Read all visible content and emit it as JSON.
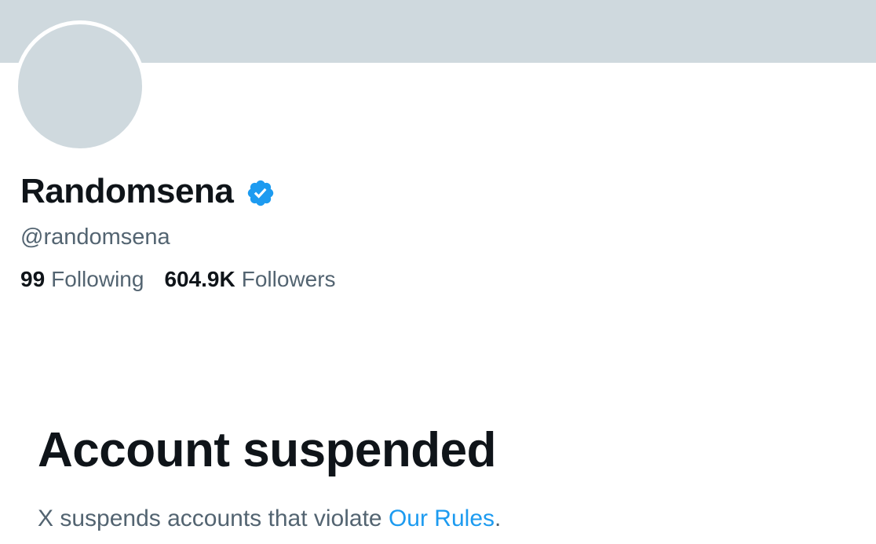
{
  "profile": {
    "display_name": "Randomsena",
    "verified_icon": "verified-badge-icon",
    "handle": "@randomsena",
    "following_count": "99",
    "following_label": "Following",
    "followers_count": "604.9K",
    "followers_label": "Followers"
  },
  "suspension": {
    "title": "Account suspended",
    "message": "X suspends accounts that violate ",
    "rules_link": "Our Rules",
    "message_end": "."
  },
  "colors": {
    "banner": "#cfd9de",
    "accent": "#1d9bf0",
    "primary_text": "#0f1419",
    "secondary_text": "#536471"
  }
}
